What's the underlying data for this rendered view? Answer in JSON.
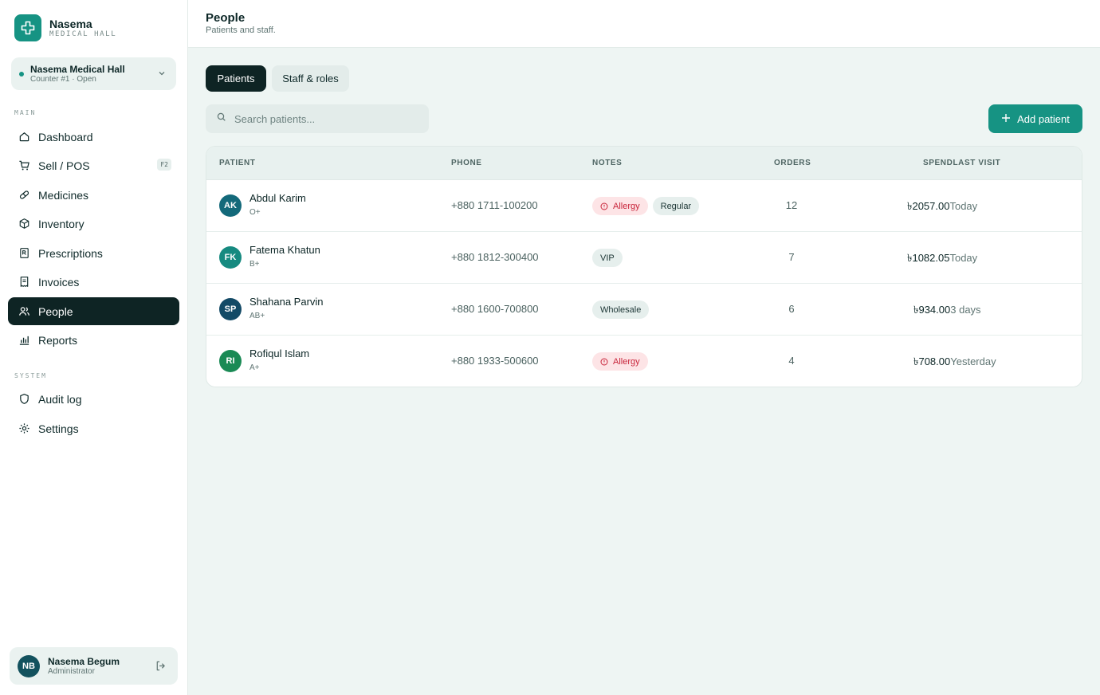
{
  "brand": {
    "name": "Nasema",
    "subtitle": "MEDICAL HALL"
  },
  "store": {
    "name": "Nasema Medical Hall",
    "status": "Counter #1 · Open"
  },
  "nav": {
    "main_label": "MAIN",
    "system_label": "SYSTEM",
    "items": [
      {
        "label": "Dashboard",
        "icon": "home-icon"
      },
      {
        "label": "Sell / POS",
        "icon": "cart-icon",
        "shortcut": "F2"
      },
      {
        "label": "Medicines",
        "icon": "pill-icon"
      },
      {
        "label": "Inventory",
        "icon": "box-icon"
      },
      {
        "label": "Prescriptions",
        "icon": "rx-icon"
      },
      {
        "label": "Invoices",
        "icon": "receipt-icon"
      },
      {
        "label": "People",
        "icon": "users-icon",
        "active": true
      },
      {
        "label": "Reports",
        "icon": "bar-chart-icon"
      }
    ],
    "system_items": [
      {
        "label": "Audit log",
        "icon": "shield-icon"
      },
      {
        "label": "Settings",
        "icon": "gear-icon"
      }
    ]
  },
  "user": {
    "initials": "NB",
    "name": "Nasema Begum",
    "role": "Administrator"
  },
  "header": {
    "title": "People",
    "subtitle": "Patients and staff."
  },
  "tabs": [
    {
      "label": "Patients",
      "active": true
    },
    {
      "label": "Staff & roles",
      "active": false
    }
  ],
  "search": {
    "placeholder": "Search patients..."
  },
  "actions": {
    "add_label": "Add patient"
  },
  "table": {
    "columns": {
      "patient": "PATIENT",
      "phone": "PHONE",
      "notes": "NOTES",
      "orders": "ORDERS",
      "spend_last": "SPENDLAST VISIT"
    },
    "rows": [
      {
        "initials": "AK",
        "avatar_color": "#13697a",
        "name": "Abdul Karim",
        "blood": "O+",
        "phone": "+880 1711-100200",
        "notes": [
          {
            "text": "Allergy",
            "kind": "allergy"
          },
          {
            "text": "Regular",
            "kind": "neutral"
          }
        ],
        "orders": "12",
        "spend": "৳2057.00",
        "last_visit": "Today"
      },
      {
        "initials": "FK",
        "avatar_color": "#168a80",
        "name": "Fatema Khatun",
        "blood": "B+",
        "phone": "+880 1812-300400",
        "notes": [
          {
            "text": "VIP",
            "kind": "neutral"
          }
        ],
        "orders": "7",
        "spend": "৳1082.05",
        "last_visit": "Today"
      },
      {
        "initials": "SP",
        "avatar_color": "#134a66",
        "name": "Shahana Parvin",
        "blood": "AB+",
        "phone": "+880 1600-700800",
        "notes": [
          {
            "text": "Wholesale",
            "kind": "neutral"
          }
        ],
        "orders": "6",
        "spend": "৳934.00",
        "last_visit": "3 days"
      },
      {
        "initials": "RI",
        "avatar_color": "#1a8a55",
        "name": "Rofiqul Islam",
        "blood": "A+",
        "phone": "+880 1933-500600",
        "notes": [
          {
            "text": "Allergy",
            "kind": "allergy"
          }
        ],
        "orders": "4",
        "spend": "৳708.00",
        "last_visit": "Yesterday"
      }
    ]
  },
  "colors": {
    "accent": "#169383",
    "dark": "#0e2424",
    "allergy": "#c8243a",
    "background": "#eef5f3"
  }
}
